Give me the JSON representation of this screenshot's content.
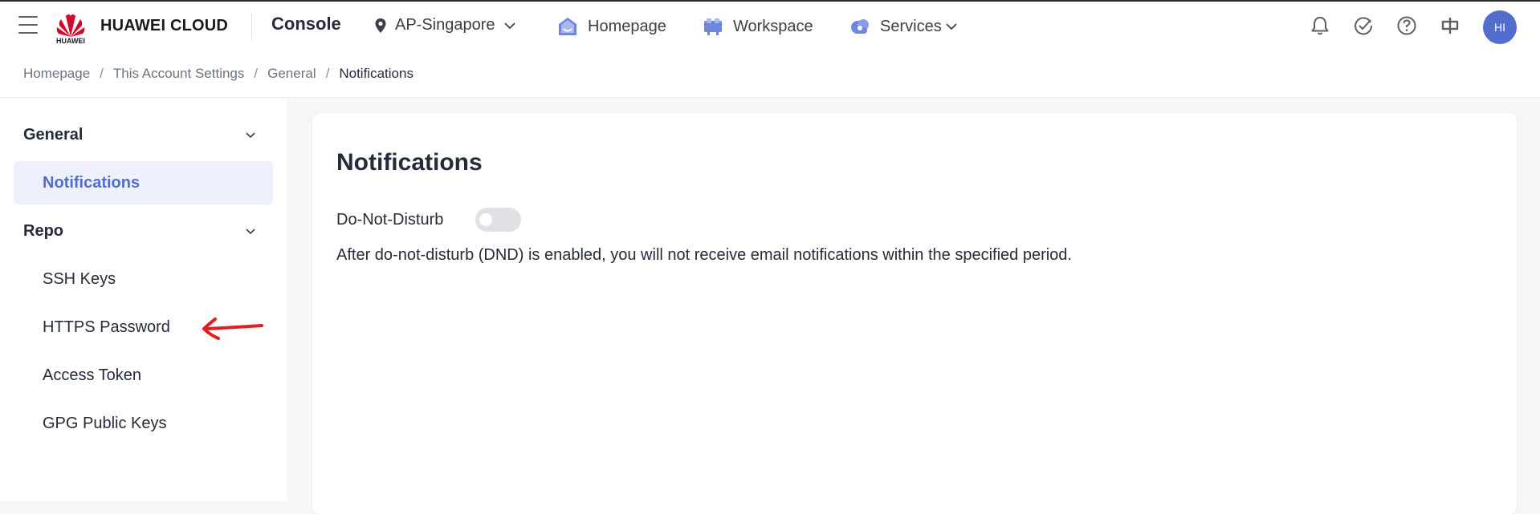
{
  "header": {
    "brand": "HUAWEI CLOUD",
    "brand_sub": "HUAWEI",
    "console": "Console",
    "region": "AP-Singapore",
    "homepage": "Homepage",
    "workspace": "Workspace",
    "services": "Services",
    "avatar": "HI",
    "icons": [
      "menu-icon",
      "location-pin-icon",
      "chevron-down-icon",
      "home-icon",
      "workspace-icon",
      "cloud-icon",
      "bell-icon",
      "check-circle-icon",
      "help-icon",
      "language-icon"
    ]
  },
  "breadcrumb": [
    "Homepage",
    "This Account Settings",
    "General",
    "Notifications"
  ],
  "sidebar": {
    "groups": [
      {
        "label": "General",
        "items": [
          "Notifications"
        ]
      },
      {
        "label": "Repo",
        "items": [
          "SSH Keys",
          "HTTPS Password",
          "Access Token",
          "GPG Public Keys"
        ]
      }
    ],
    "active": "Notifications"
  },
  "main": {
    "title": "Notifications",
    "dnd_label": "Do-Not-Disturb",
    "dnd_enabled": false,
    "dnd_description": "After do-not-disturb (DND) is enabled, you will not receive email notifications within the specified period."
  },
  "colors": {
    "accent": "#526ecc",
    "active_bg": "#eef0fc",
    "brand_red": "#cf0a2c",
    "annotation": "#e02020"
  }
}
